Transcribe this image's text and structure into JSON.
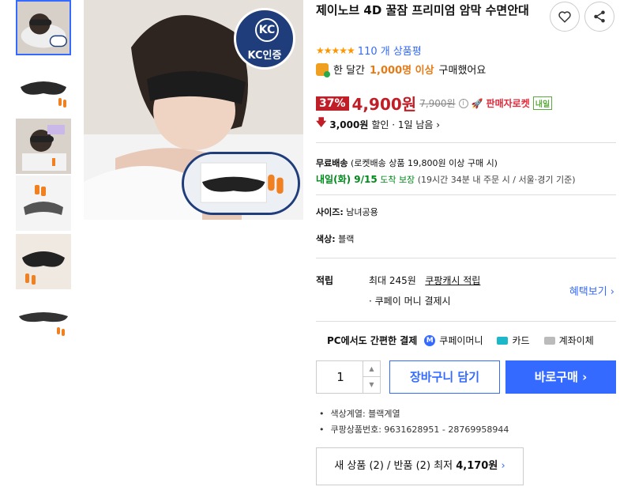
{
  "product": {
    "title": "제이노브 4D 꿀잠 프리미엄 암막 수면안대",
    "rating_stars": "★★★★★",
    "review_count": "110 개 상품평",
    "bought": {
      "prefix": "한 달간",
      "highlight": "1,000명 이상",
      "suffix": "구매했어요"
    }
  },
  "image": {
    "kc_label": "KC인증",
    "kc_logo": "KC"
  },
  "price": {
    "discount": "37%",
    "sale": "4,900원",
    "original": "7,900원",
    "seller_badge": "판매자로켓",
    "naeil_badge": "내일",
    "coupon_amount": "3,000원",
    "coupon_text": "할인 · 1일 남음 ›"
  },
  "shipping": {
    "free_label": "무료배송",
    "free_desc": "(로켓배송 상품 19,800원 이상 구매 시)",
    "arrival": "내일(화) 9/15",
    "arrival_guarantee": "도착 보장",
    "arrival_note": "(19시간 34분 내 주문 시 / 서울·경기 기준)"
  },
  "options": {
    "size_label": "사이즈:",
    "size_value": "남녀공용",
    "color_label": "색상:",
    "color_value": "블랙"
  },
  "benefit": {
    "label": "적립",
    "line1_prefix": "최대 245원",
    "line1_link": "쿠팡캐시 적립",
    "line2": "· 쿠페이 머니 결제시",
    "more": "혜택보기 ›"
  },
  "payment": {
    "label": "PC에서도 간편한 결제",
    "method1": "쿠페이머니",
    "method2": "카드",
    "method3": "계좌이체"
  },
  "purchase": {
    "quantity": "1",
    "cart_label": "장바구니 담기",
    "buy_label": "바로구매 ›"
  },
  "details": [
    "색상계열: 블랙계열",
    "쿠팡상품번호: 9631628951 - 28769958944"
  ],
  "other_sellers": {
    "prefix": "새 상품 (2) / 반품 (2) 최저",
    "price": "4,170원",
    "chevron": "›"
  },
  "colors": {
    "accent": "#346aff",
    "sale": "#c11f28",
    "green": "#00891a",
    "orange": "#e57b17"
  }
}
